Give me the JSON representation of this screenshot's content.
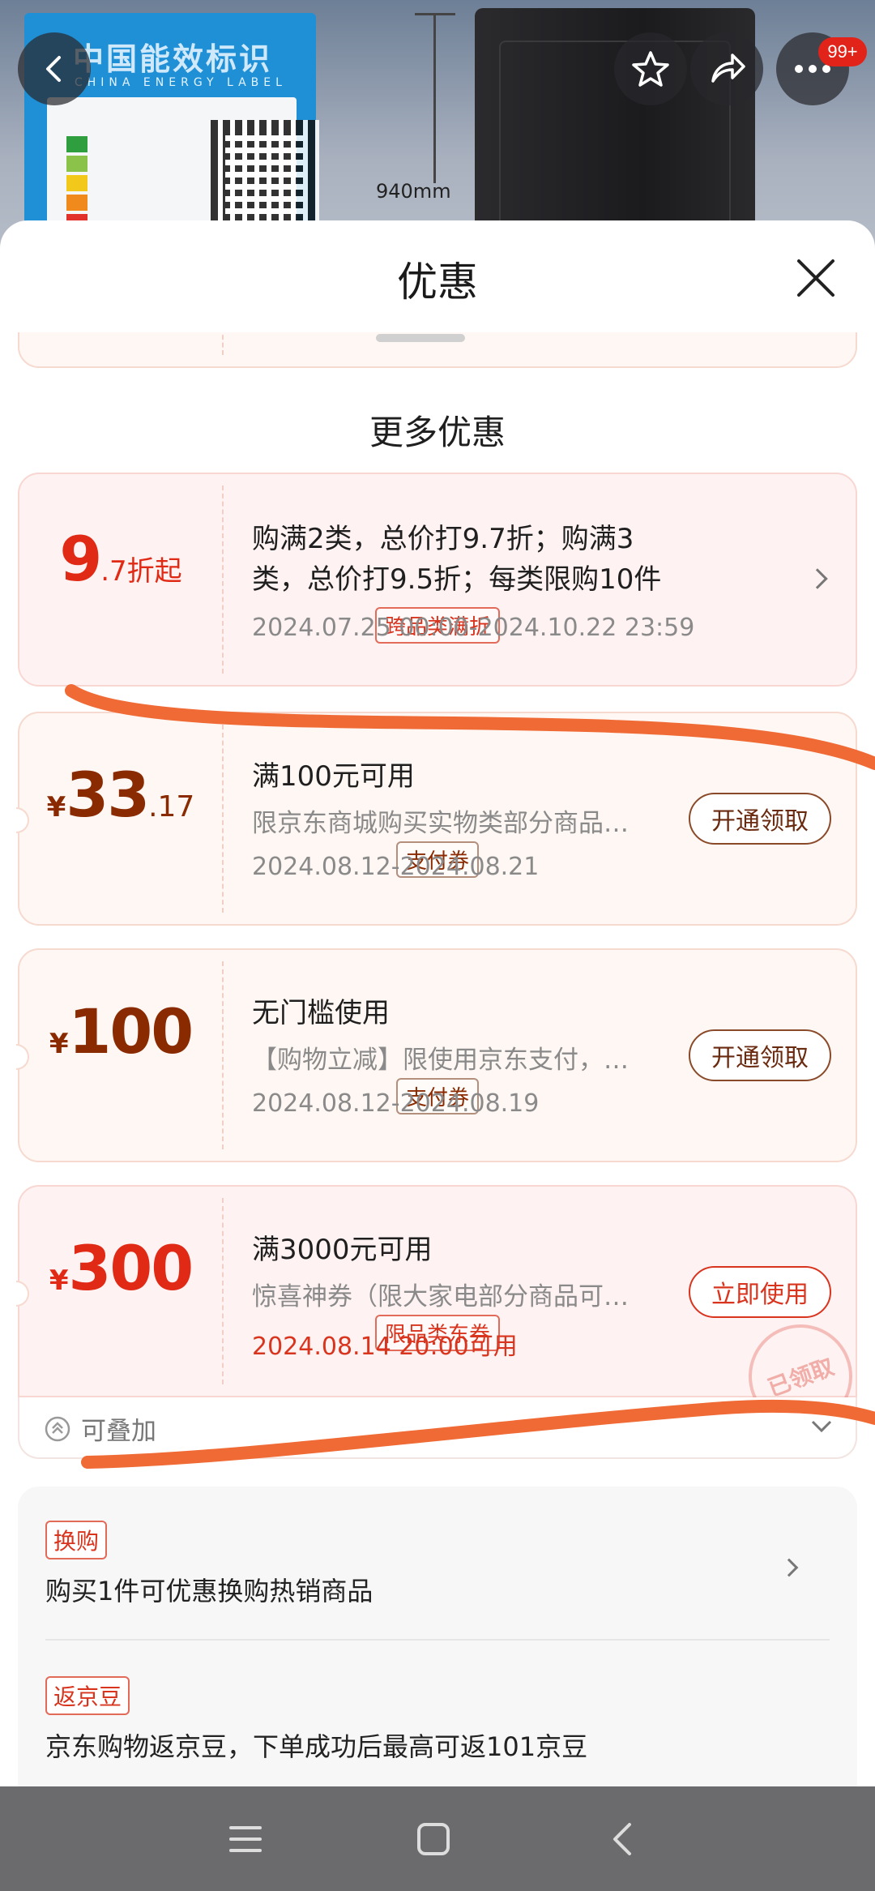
{
  "backdrop": {
    "energy_label_cn": "中国能效标识",
    "energy_label_en": "CHINA ENERGY LABEL",
    "dimension_text": "940mm",
    "notification_count": "99+"
  },
  "sheet": {
    "title": "优惠",
    "more_title": "更多优惠"
  },
  "cards": [
    {
      "amount_big": "9",
      "amount_small": ".7折起",
      "tag": "跨品类满折",
      "title_line1": "购满2类，总价打9.7折；购满3",
      "title_line2": "类，总价打9.5折；每类限购10件",
      "date": "2024.07.25 00:00-2024.10.22 23:59"
    },
    {
      "currency": "¥",
      "amount_big": "33",
      "amount_small": ".17",
      "tag": "支付券",
      "title": "满100元可用",
      "desc": "限京东商城购买实物类部分商品…",
      "date": "2024.08.12-2024.08.21",
      "button": "开通领取"
    },
    {
      "currency": "¥",
      "amount_big": "100",
      "tag": "支付券",
      "title": "无门槛使用",
      "desc": "【购物立减】限使用京东支付，…",
      "date": "2024.08.12-2024.08.19",
      "button": "开通领取"
    },
    {
      "currency": "¥",
      "amount_big": "300",
      "tag": "限品类东券",
      "title": "满3000元可用",
      "desc": "惊喜神券（限大家电部分商品可…",
      "date": "2024.08.14 20:00可用",
      "button": "立即使用",
      "stamp": "已领取",
      "stack_label": "可叠加"
    }
  ],
  "extras": [
    {
      "tag": "换购",
      "text": "购买1件可优惠换购热销商品"
    },
    {
      "tag": "返京豆",
      "text": "京东购物返京豆，下单成功后最高可返101京豆"
    }
  ],
  "colors": {
    "accent_red": "#e12a16",
    "coupon_brown": "#8a2a00",
    "annotation_orange": "#f06a35"
  }
}
